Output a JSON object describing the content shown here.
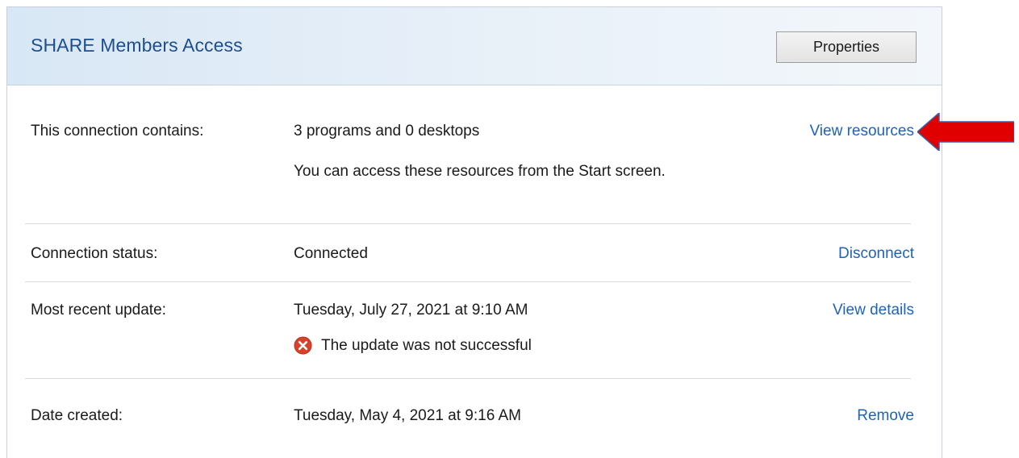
{
  "header": {
    "title": "SHARE Members Access",
    "properties_label": "Properties"
  },
  "rows": {
    "contains": {
      "label": "This connection contains:",
      "value": "3 programs and 0 desktops",
      "note": "You can access these resources from the Start screen.",
      "action": "View resources"
    },
    "status": {
      "label": "Connection status:",
      "value": "Connected",
      "action": "Disconnect"
    },
    "update": {
      "label": "Most recent update:",
      "value": "Tuesday, July 27, 2021 at 9:10 AM",
      "error": "The update was not successful",
      "action": "View details"
    },
    "created": {
      "label": "Date created:",
      "value": "Tuesday, May 4, 2021 at 9:16 AM",
      "action": "Remove"
    }
  },
  "icons": {
    "error": "error-x-icon",
    "annotation": "red-arrow-icon"
  },
  "colors": {
    "title": "#1e4f8c",
    "link": "#1f63b5",
    "error": "#d9412b",
    "arrow": "#e00000"
  }
}
